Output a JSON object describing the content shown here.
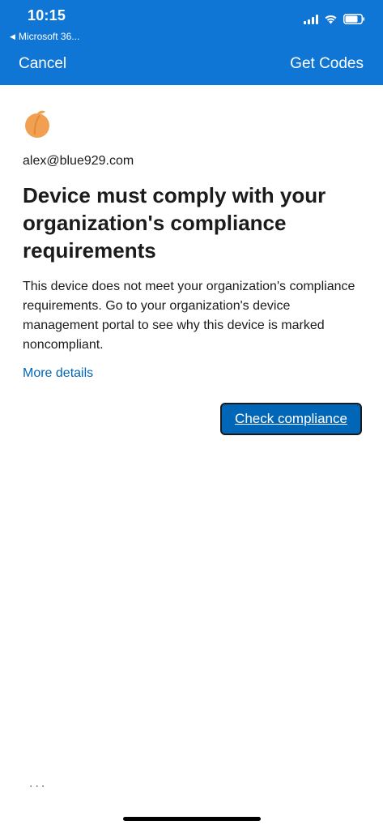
{
  "status_bar": {
    "time": "10:15",
    "back_app": "Microsoft 36..."
  },
  "nav": {
    "cancel_label": "Cancel",
    "get_codes_label": "Get Codes"
  },
  "main": {
    "email": "alex@blue929.com",
    "title": "Device must comply with your organization's compliance requirements",
    "description": "This device does not meet your organization's compliance requirements. Go to your organization's device management portal to see why this device is marked noncompliant.",
    "more_details_label": "More details",
    "check_compliance_label": "Check compliance"
  },
  "footer": {
    "more_options": "..."
  },
  "colors": {
    "header_bg": "#0f76d6",
    "link": "#0067b8",
    "button_bg": "#0067b8",
    "logo": "#f0a050"
  },
  "icons": {
    "logo": "peach-logo-icon",
    "signal": "cellular-signal-icon",
    "wifi": "wifi-icon",
    "battery": "battery-icon",
    "back": "back-triangle-icon"
  }
}
